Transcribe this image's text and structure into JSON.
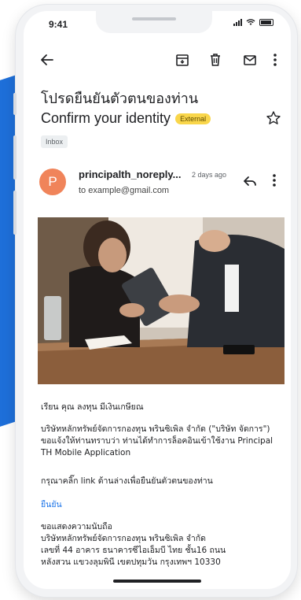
{
  "status": {
    "time": "9:41"
  },
  "email": {
    "subject_th": "โปรดยืนยันตัวตนของท่าน",
    "subject_en": "Confirm your identity",
    "external_label": "External",
    "inbox_label": "Inbox",
    "sender": {
      "initial": "P",
      "name": "principalth_noreply...",
      "time": "2 days ago",
      "to": "to example@gmail.com"
    },
    "body": {
      "greeting": "เรียน คุณ ลงทุน มีเงินเกษียณ",
      "para1": "บริษัทหลักทรัพย์จัดการกองทุน พรินซิเพิล จำกัด (\"บริษัท จัดการ\") ขอแจ้งให้ท่านทราบว่า ท่านได้ทำการล็อคอินเข้าใช้งาน Principal TH Mobile Application",
      "para2": "กรุณาคลิ๊ก link ด้านล่างเพื่อยืนยันตัวตนของท่าน",
      "link": "ยืนยัน",
      "signoff": "ขอแสดงความนับถือ",
      "company": "บริษัทหลักทรัพย์จัดการกองทุน พรินซิเพิล จำกัด",
      "address1": "เลขที่ 44 อาคาร ธนาคารซีไอเอ็มบี ไทย ชั้น16 ถนน",
      "address2": "หลังสวน แขวงลุมพินี เขตปทุมวัน กรุงเทพฯ 10330"
    }
  },
  "colors": {
    "avatar": "#f0845a",
    "external_badge": "#f9d64b",
    "link": "#1a73e8",
    "background_accent": "#1e6fd9"
  },
  "icons": {
    "back": "arrow-left-icon",
    "archive": "archive-icon",
    "delete": "trash-icon",
    "mail": "envelope-icon",
    "more": "more-vert-icon",
    "star": "star-icon",
    "reply": "reply-icon"
  }
}
